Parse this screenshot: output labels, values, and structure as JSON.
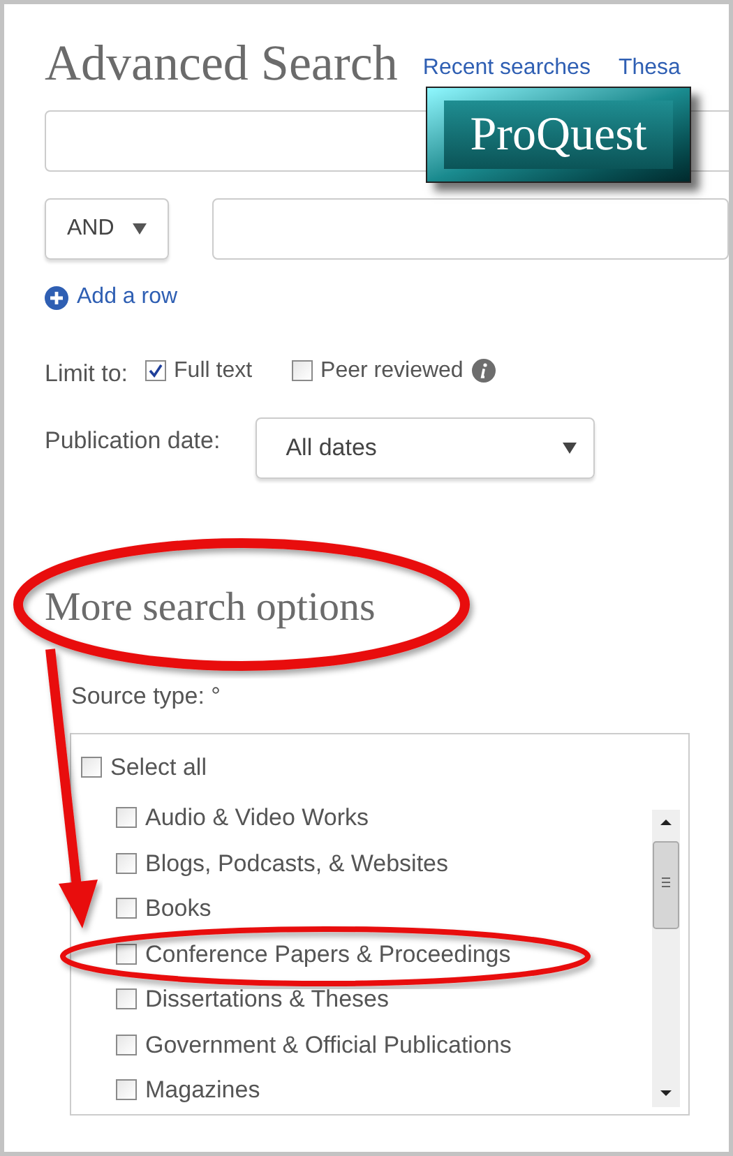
{
  "header": {
    "title": "Advanced Search",
    "links": [
      "Recent searches",
      "Thesa"
    ]
  },
  "logo": {
    "text": "ProQuest"
  },
  "search": {
    "operator": "AND"
  },
  "add_row": "Add a row",
  "limit": {
    "label": "Limit to:",
    "options": [
      {
        "label": "Full text",
        "checked": true
      },
      {
        "label": "Peer reviewed",
        "checked": false,
        "info": true
      }
    ]
  },
  "publication_date": {
    "label": "Publication date:",
    "value": "All dates"
  },
  "more_options": {
    "title": "More search options",
    "source_type_label": "Source type: °",
    "select_all": {
      "label": "Select all",
      "checked": false
    },
    "items": [
      {
        "label": "Audio & Video Works",
        "checked": false
      },
      {
        "label": "Blogs, Podcasts, & Websites",
        "checked": false
      },
      {
        "label": "Books",
        "checked": false
      },
      {
        "label": "Conference Papers & Proceedings",
        "checked": false
      },
      {
        "label": "Dissertations & Theses",
        "checked": false
      },
      {
        "label": "Government & Official Publications",
        "checked": false
      },
      {
        "label": "Magazines",
        "checked": false
      }
    ]
  }
}
